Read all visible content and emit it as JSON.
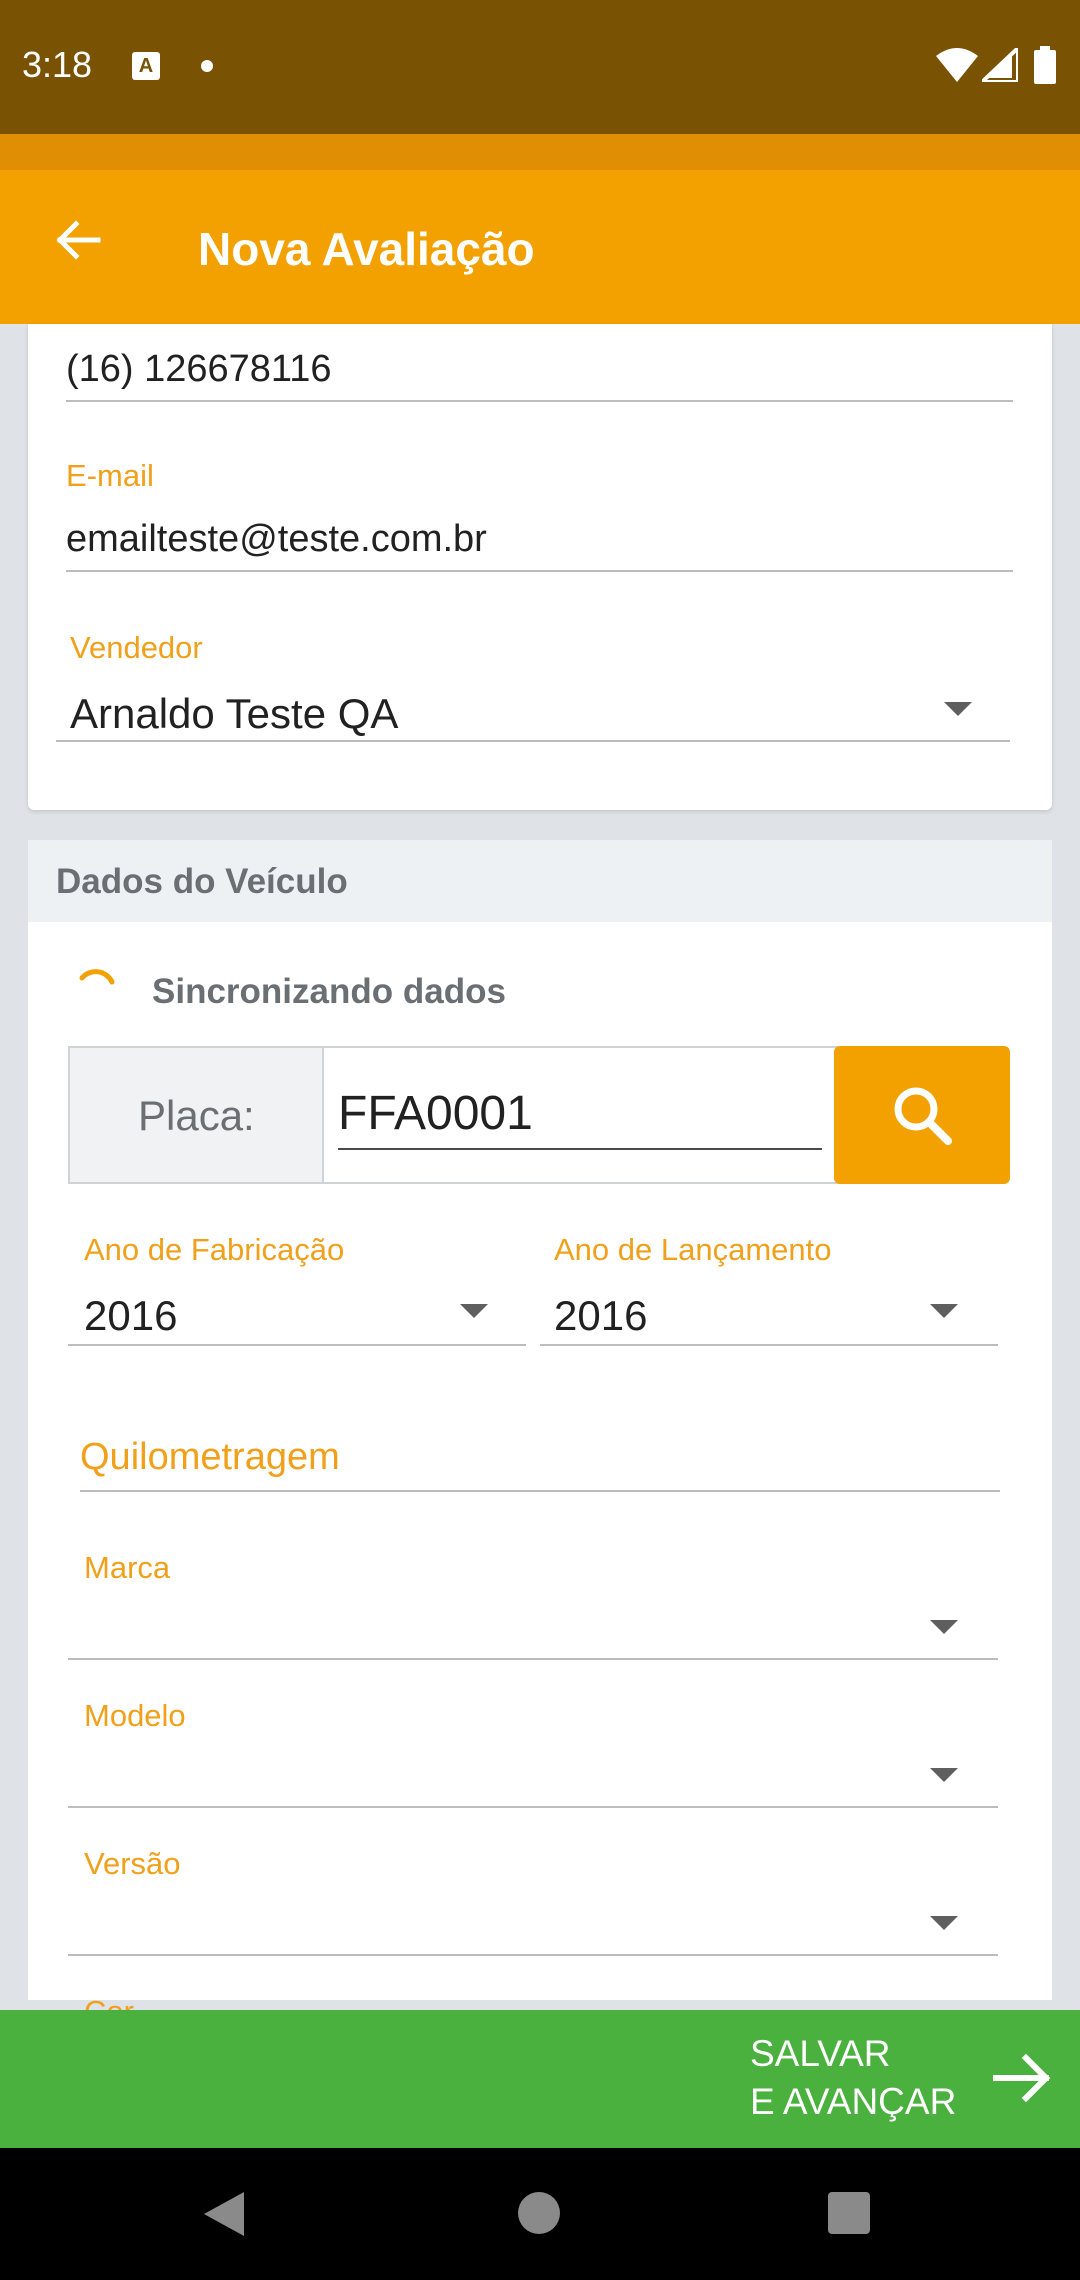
{
  "status_bar": {
    "time": "3:18",
    "notification_icon": "A",
    "icons": [
      "wifi-icon",
      "signal-icon",
      "battery-icon"
    ]
  },
  "app_bar": {
    "title": "Nova Avaliação",
    "back_icon": "arrow-left-icon"
  },
  "contact": {
    "phone_value": "(16) 126678116",
    "email_label": "E-mail",
    "email_value": "emailteste@teste.com.br",
    "seller_label": "Vendedor",
    "seller_value": "Arnaldo Teste QA"
  },
  "vehicle": {
    "section_title": "Dados do Veículo",
    "sync_text": "Sincronizando dados",
    "plate_label": "Placa:",
    "plate_value": "FFA0001",
    "year_manufacture_label": "Ano de Fabricação",
    "year_manufacture_value": "2016",
    "year_launch_label": "Ano de Lançamento",
    "year_launch_value": "2016",
    "mileage_placeholder": "Quilometragem",
    "brand_label": "Marca",
    "model_label": "Modelo",
    "version_label": "Versão",
    "color_label": "Cor"
  },
  "actions": {
    "save_line1": "SALVAR",
    "save_line2": "E AVANÇAR"
  },
  "colors": {
    "status_bar": "#7a5203",
    "app_bar": "#f3a001",
    "accent_label": "#f0a01a",
    "save_button": "#4ab13f"
  }
}
